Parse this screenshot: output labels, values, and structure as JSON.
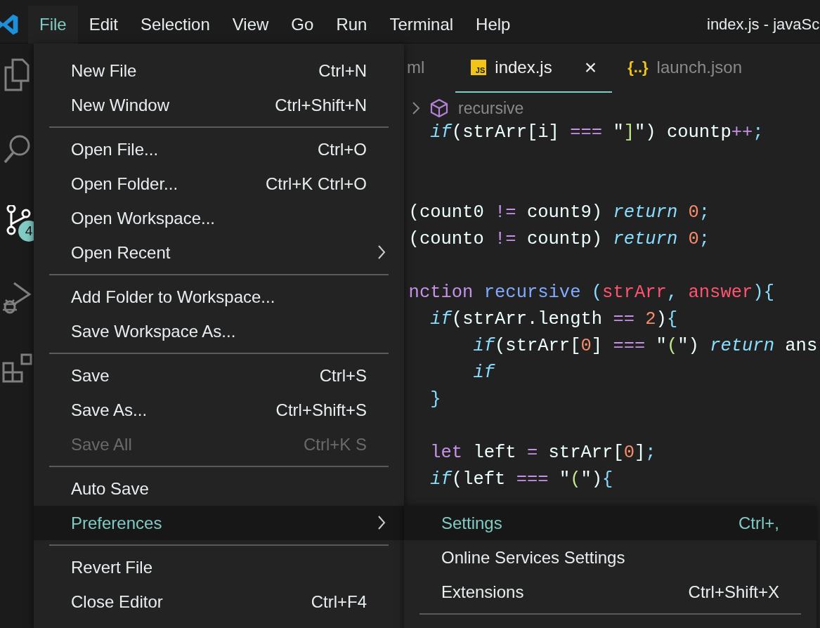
{
  "menubar": {
    "items": [
      {
        "label": "File",
        "selected": true
      },
      {
        "label": "Edit",
        "selected": false
      },
      {
        "label": "Selection",
        "selected": false
      },
      {
        "label": "View",
        "selected": false
      },
      {
        "label": "Go",
        "selected": false
      },
      {
        "label": "Run",
        "selected": false
      },
      {
        "label": "Terminal",
        "selected": false
      },
      {
        "label": "Help",
        "selected": false
      }
    ],
    "window_title": "index.js - javaSc"
  },
  "activity_bar": [
    {
      "kind": "files",
      "selected": false
    },
    {
      "kind": "search",
      "selected": false
    },
    {
      "kind": "source-control",
      "selected": false,
      "badge": "4"
    },
    {
      "kind": "run-debug",
      "selected": false
    },
    {
      "kind": "extensions",
      "selected": false
    }
  ],
  "tabs": [
    {
      "kind": "plain",
      "label": "ml",
      "selected": false
    },
    {
      "kind": "js",
      "label": "index.js",
      "selected": true,
      "icon_text": "JS",
      "close": "×"
    },
    {
      "kind": "json",
      "label": "launch.json",
      "selected": false,
      "icon_text": "{..}"
    }
  ],
  "breadcrumb": {
    "label": "recursive"
  },
  "code_lines": [
    {
      "kind": "code",
      "tokens": [
        {
          "text": "    if",
          "kind": "kw"
        },
        {
          "text": "(strArr[i] ",
          "kind": "p"
        },
        {
          "text": "===",
          "kind": "op"
        },
        {
          "text": " \"",
          "kind": "p"
        },
        {
          "text": "]",
          "kind": "str"
        },
        {
          "text": "\") countp",
          "kind": "p"
        },
        {
          "text": "++",
          "kind": "op"
        },
        {
          "text": ";",
          "kind": "punc"
        }
      ]
    },
    {
      "kind": "blank"
    },
    {
      "kind": "blank"
    },
    {
      "kind": "code",
      "tokens": [
        {
          "text": "  (count0 ",
          "kind": "p"
        },
        {
          "text": "!=",
          "kind": "op"
        },
        {
          "text": " count9) ",
          "kind": "p"
        },
        {
          "text": "return",
          "kind": "kw"
        },
        {
          "text": " 0",
          "kind": "num"
        },
        {
          "text": ";",
          "kind": "punc"
        }
      ]
    },
    {
      "kind": "code",
      "tokens": [
        {
          "text": "  (counto ",
          "kind": "p"
        },
        {
          "text": "!=",
          "kind": "op"
        },
        {
          "text": " countp) ",
          "kind": "p"
        },
        {
          "text": "return",
          "kind": "kw"
        },
        {
          "text": " 0",
          "kind": "num"
        },
        {
          "text": ";",
          "kind": "punc"
        }
      ]
    },
    {
      "kind": "blank"
    },
    {
      "kind": "code",
      "tokens": [
        {
          "text": "  nction ",
          "kind": "decl"
        },
        {
          "text": "recursive",
          "kind": "fn"
        },
        {
          "text": " (",
          "kind": "punc"
        },
        {
          "text": "strArr",
          "kind": "param"
        },
        {
          "text": ", ",
          "kind": "punc"
        },
        {
          "text": "answer",
          "kind": "param"
        },
        {
          "text": "){",
          "kind": "punc"
        }
      ]
    },
    {
      "kind": "code",
      "tokens": [
        {
          "text": "    if",
          "kind": "kw"
        },
        {
          "text": "(strArr.length ",
          "kind": "p"
        },
        {
          "text": "==",
          "kind": "op"
        },
        {
          "text": " 2",
          "kind": "num"
        },
        {
          "text": ")",
          "kind": "p"
        },
        {
          "text": "{",
          "kind": "punc"
        }
      ]
    },
    {
      "kind": "code",
      "tokens": [
        {
          "text": "        if",
          "kind": "kw"
        },
        {
          "text": "(strArr[",
          "kind": "p"
        },
        {
          "text": "0",
          "kind": "num"
        },
        {
          "text": "] ",
          "kind": "p"
        },
        {
          "text": "===",
          "kind": "op"
        },
        {
          "text": " \"",
          "kind": "p"
        },
        {
          "text": "(",
          "kind": "str"
        },
        {
          "text": "\") ",
          "kind": "p"
        },
        {
          "text": "return",
          "kind": "kw"
        },
        {
          "text": " ans",
          "kind": "p"
        }
      ]
    },
    {
      "kind": "code",
      "tokens": [
        {
          "text": "        if",
          "kind": "kw"
        }
      ]
    },
    {
      "kind": "code",
      "tokens": [
        {
          "text": "    }",
          "kind": "punc"
        }
      ]
    },
    {
      "kind": "blank"
    },
    {
      "kind": "code",
      "tokens": [
        {
          "text": "    let",
          "kind": "decl"
        },
        {
          "text": " left ",
          "kind": "p"
        },
        {
          "text": "=",
          "kind": "op"
        },
        {
          "text": " strArr[",
          "kind": "p"
        },
        {
          "text": "0",
          "kind": "num"
        },
        {
          "text": "]",
          "kind": "p"
        },
        {
          "text": ";",
          "kind": "punc"
        }
      ]
    },
    {
      "kind": "code",
      "tokens": [
        {
          "text": "    if",
          "kind": "kw"
        },
        {
          "text": "(left ",
          "kind": "p"
        },
        {
          "text": "===",
          "kind": "op"
        },
        {
          "text": " \"",
          "kind": "p"
        },
        {
          "text": "(",
          "kind": "str"
        },
        {
          "text": "\")",
          "kind": "p"
        },
        {
          "text": "{",
          "kind": "punc"
        }
      ]
    }
  ],
  "file_menu": {
    "groups": [
      [
        {
          "label": "New File",
          "shortcut": "Ctrl+N",
          "submenu": false,
          "selected": false,
          "disabled": false
        },
        {
          "label": "New Window",
          "shortcut": "Ctrl+Shift+N",
          "submenu": false,
          "selected": false,
          "disabled": false
        }
      ],
      [
        {
          "label": "Open File...",
          "shortcut": "Ctrl+O",
          "submenu": false,
          "selected": false,
          "disabled": false
        },
        {
          "label": "Open Folder...",
          "shortcut": "Ctrl+K Ctrl+O",
          "submenu": false,
          "selected": false,
          "disabled": false
        },
        {
          "label": "Open Workspace...",
          "submenu": false,
          "selected": false,
          "disabled": false
        },
        {
          "label": "Open Recent",
          "submenu": true,
          "selected": false,
          "disabled": false
        }
      ],
      [
        {
          "label": "Add Folder to Workspace...",
          "submenu": false,
          "selected": false,
          "disabled": false
        },
        {
          "label": "Save Workspace As...",
          "submenu": false,
          "selected": false,
          "disabled": false
        }
      ],
      [
        {
          "label": "Save",
          "shortcut": "Ctrl+S",
          "submenu": false,
          "selected": false,
          "disabled": false
        },
        {
          "label": "Save As...",
          "shortcut": "Ctrl+Shift+S",
          "submenu": false,
          "selected": false,
          "disabled": false
        },
        {
          "label": "Save All",
          "shortcut": "Ctrl+K S",
          "submenu": false,
          "selected": false,
          "disabled": true
        }
      ],
      [
        {
          "label": "Auto Save",
          "submenu": false,
          "selected": false,
          "disabled": false
        },
        {
          "label": "Preferences",
          "submenu": true,
          "selected": true,
          "disabled": false
        }
      ],
      [
        {
          "label": "Revert File",
          "submenu": false,
          "selected": false,
          "disabled": false
        },
        {
          "label": "Close Editor",
          "shortcut": "Ctrl+F4",
          "submenu": false,
          "selected": false,
          "disabled": false
        }
      ]
    ]
  },
  "preferences_submenu": {
    "groups": [
      [
        {
          "label": "Settings",
          "shortcut": "Ctrl+,",
          "selected": true
        },
        {
          "label": "Online Services Settings",
          "selected": false
        },
        {
          "label": "Extensions",
          "shortcut": "Ctrl+Shift+X",
          "selected": false
        }
      ]
    ]
  }
}
